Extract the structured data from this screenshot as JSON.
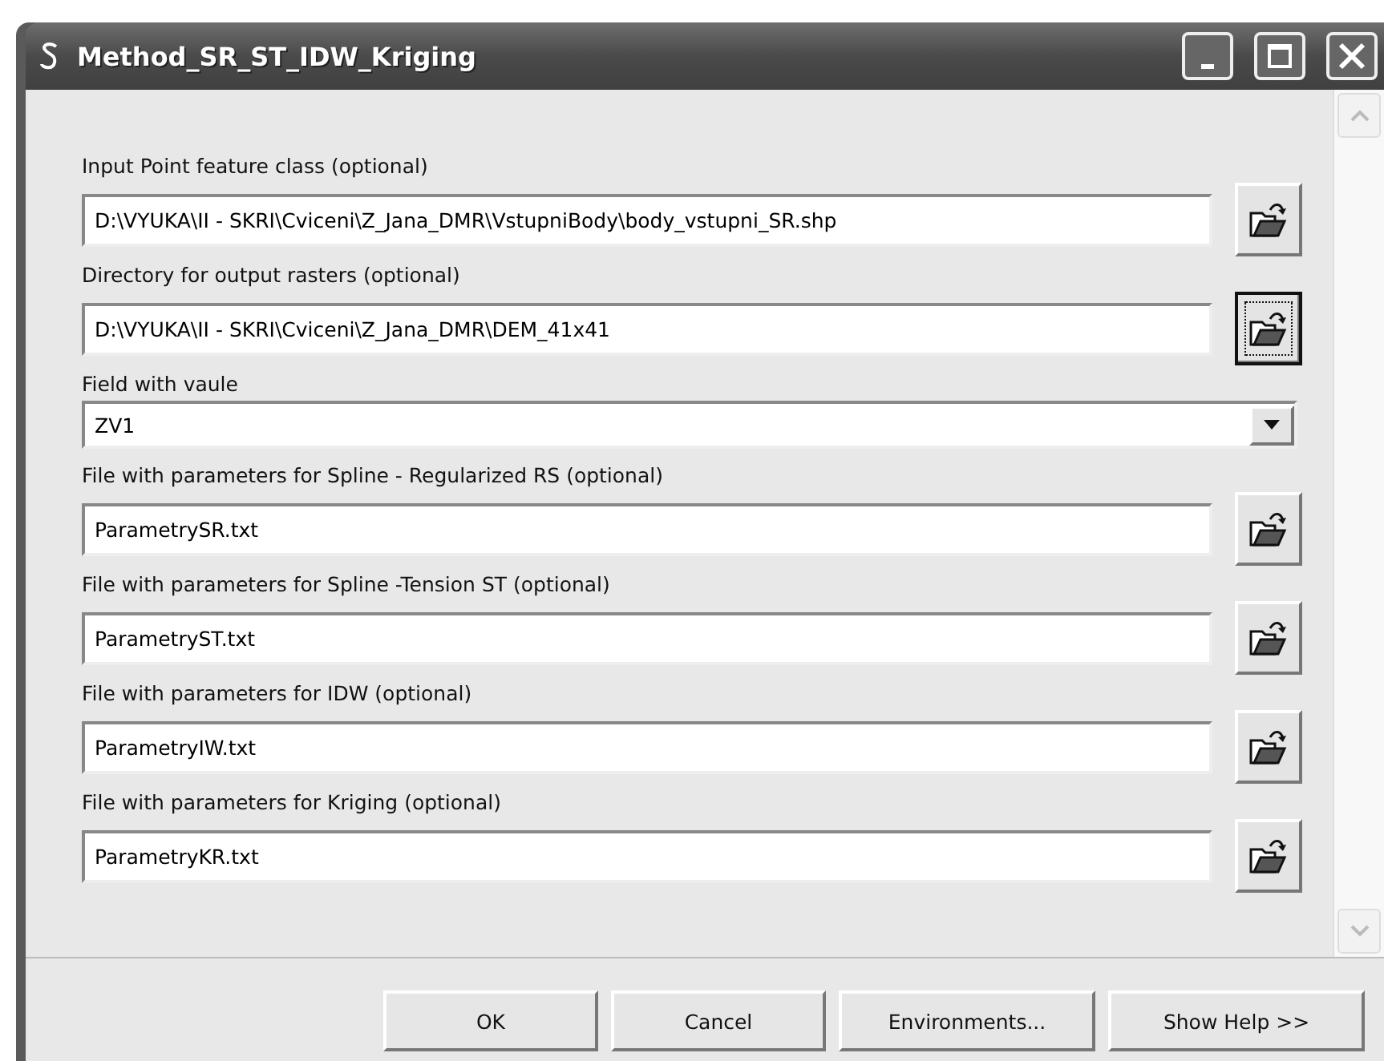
{
  "window": {
    "title": "Method_SR_ST_IDW_Kriging"
  },
  "parameters": [
    {
      "kind": "file",
      "label": "Input Point feature class (optional)",
      "value": "D:\\VYUKA\\II - SKRI\\Cviceni\\Z_Jana_DMR\\VstupniBody\\body_vstupni_SR.shp",
      "focused": false
    },
    {
      "kind": "file",
      "label": "Directory for output rasters (optional)",
      "value": "D:\\VYUKA\\II - SKRI\\Cviceni\\Z_Jana_DMR\\DEM_41x41",
      "focused": true
    },
    {
      "kind": "combo",
      "label": "Field with vaule",
      "value": "ZV1"
    },
    {
      "kind": "file",
      "label": "File with parameters for Spline - Regularized RS (optional)",
      "value": "ParametrySR.txt",
      "focused": false
    },
    {
      "kind": "file",
      "label": "File with parameters for Spline -Tension ST (optional)",
      "value": "ParametryST.txt",
      "focused": false
    },
    {
      "kind": "file",
      "label": "File with parameters for IDW (optional)",
      "value": "ParametryIW.txt",
      "focused": false
    },
    {
      "kind": "file",
      "label": "File with parameters for Kriging (optional)",
      "value": "ParametryKR.txt",
      "focused": false
    }
  ],
  "buttons": [
    "OK",
    "Cancel",
    "Environments...",
    "Show Help >>"
  ]
}
